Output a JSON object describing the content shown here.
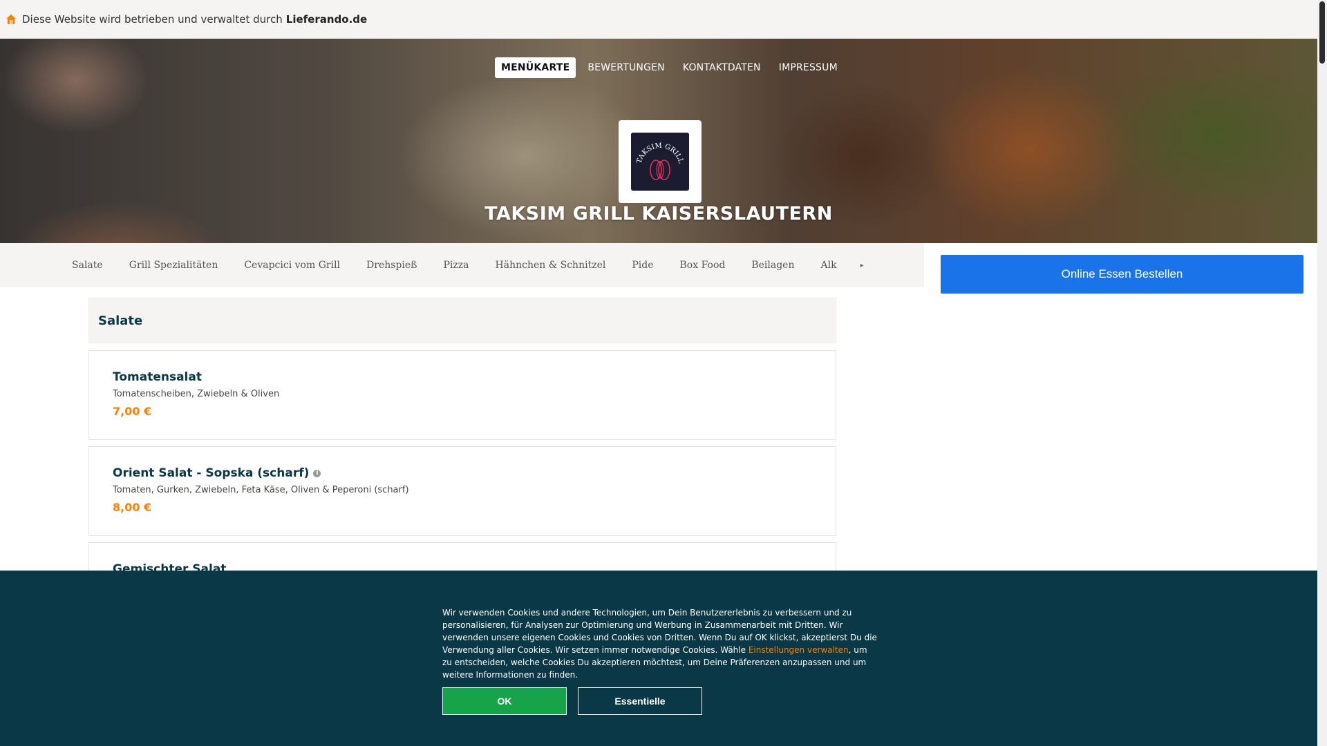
{
  "topbar": {
    "text": "Diese Website wird betrieben und verwaltet durch",
    "brand": "Lieferando.de",
    "icon": "home-icon"
  },
  "hero": {
    "nav": [
      "MENÜKARTE",
      "BEWERTUNGEN",
      "KONTAKTDATEN",
      "IMPRESSUM"
    ],
    "active_nav": "MENÜKARTE",
    "logo_text": "TAKSIM GRILL",
    "restaurant_name": "TAKSIM GRILL KAISERSLAUTERN"
  },
  "categories": [
    "Salate",
    "Grill Spezialitäten",
    "Cevapcici vom Grill",
    "Drehspieß",
    "Pizza",
    "Hähnchen & Schnitzel",
    "Pide",
    "Box Food",
    "Beilagen",
    "Alk"
  ],
  "order_button": "Online Essen Bestellen",
  "menu": {
    "section_title": "Salate",
    "items": [
      {
        "name": "Tomatensalat",
        "desc": "Tomatenscheiben, Zwiebeln & Oliven",
        "price": "7,00 €"
      },
      {
        "name": "Orient Salat - Sopska (scharf)",
        "desc": "Tomaten, Gurken, Zwiebeln, Feta Käse, Oliven & Peperoni (scharf)",
        "price": "8,00 €"
      },
      {
        "name": "Gemischter Salat",
        "desc": "",
        "price": ""
      }
    ]
  },
  "cookie": {
    "text_before": "Wir verwenden Cookies und andere Technologien, um Dein Benutzererlebnis zu verbessern und zu personalisieren, für Analysen zur Optimierung und Werbung in Zusammenarbeit mit Dritten. Wir verwenden unsere eigenen Cookies und Cookies von Dritten. Wenn Du auf OK klickst, akzeptierst Du die Verwendung aller Cookies. Wir setzen immer notwendige Cookies. Wähle ",
    "link": "Einstellungen verwalten",
    "text_after": ", um zu entscheiden, welche Cookies Du akzeptieren möchtest, um Deine Präferenzen anzupassen und um weitere Informationen zu finden.",
    "ok_label": "OK",
    "essential_label": "Essentielle"
  },
  "colors": {
    "primary_blue": "#1a73e8",
    "price_orange": "#ff8000",
    "banner_dark": "#0a3847",
    "ok_green": "#17a34a"
  }
}
